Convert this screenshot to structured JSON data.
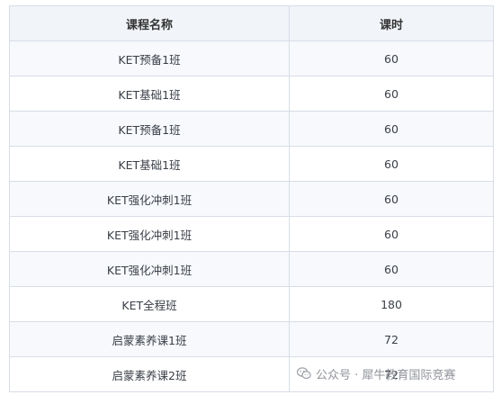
{
  "table": {
    "headers": [
      "课程名称",
      "课时"
    ],
    "rows": [
      {
        "course": "KET预备1班",
        "hours": "60"
      },
      {
        "course": "KET基础1班",
        "hours": "60"
      },
      {
        "course": "KET预备1班",
        "hours": "60"
      },
      {
        "course": "KET基础1班",
        "hours": "60"
      },
      {
        "course": "KET强化冲刺1班",
        "hours": "60"
      },
      {
        "course": "KET强化冲刺1班",
        "hours": "60"
      },
      {
        "course": "KET强化冲刺1班",
        "hours": "60"
      },
      {
        "course": "KET全程班",
        "hours": "180"
      },
      {
        "course": "启蒙素养课1班",
        "hours": "72"
      },
      {
        "course": "启蒙素养课2班",
        "hours": "72"
      }
    ]
  },
  "watermark": {
    "icon": "wechat-icon",
    "text": "公众号 · 犀牛教育国际竞赛"
  }
}
